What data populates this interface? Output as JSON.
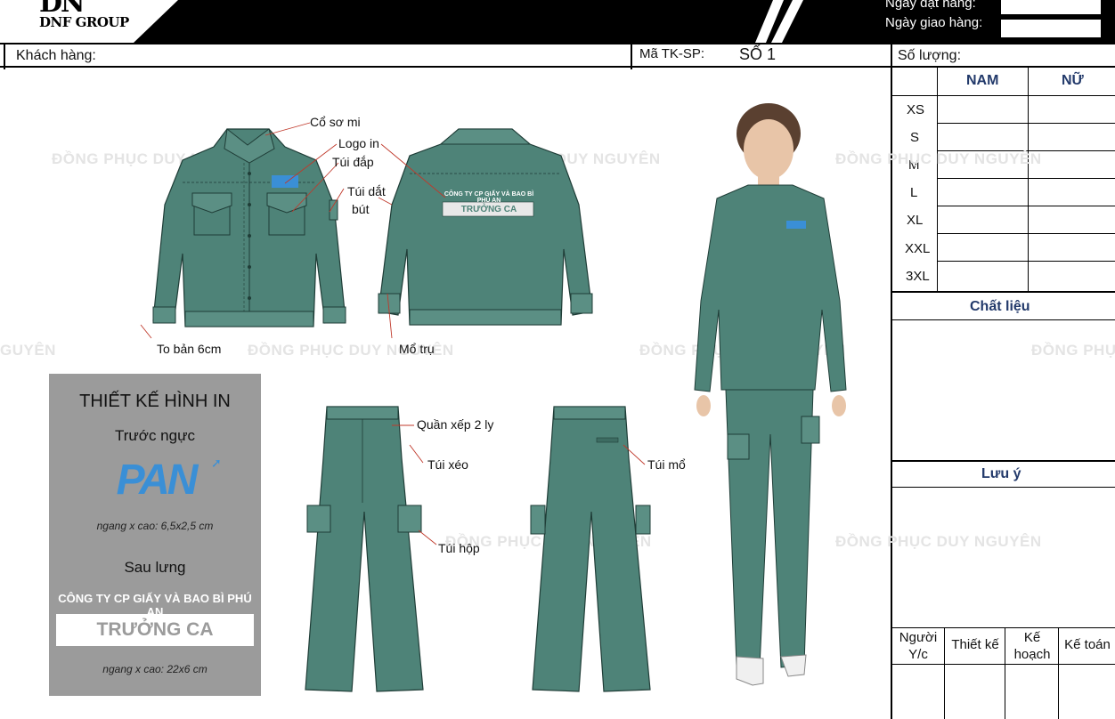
{
  "header": {
    "brand_mark": "DN",
    "brand_name": "DNF GROUP",
    "order_date_label": "Ngày đặt hàng:",
    "delivery_date_label": "Ngày giao hàng:"
  },
  "info_row": {
    "customer_label": "Khách hàng:",
    "design_code_label": "Mã TK-SP:",
    "design_code_value": "SỐ 1",
    "quantity_label": "Số lượng:"
  },
  "size_table": {
    "col_male": "NAM",
    "col_female": "NỮ",
    "sizes": [
      "XS",
      "S",
      "M",
      "L",
      "XL",
      "XXL",
      "3XL"
    ]
  },
  "material_title": "Chất liệu",
  "note_title": "Lưu ý",
  "signatures": [
    "Người Y/c",
    "Thiết kế",
    "Kế hoạch",
    "Kế toán"
  ],
  "watermark": "ĐỒNG PHỤC DUY NGUYÊN",
  "watermark_fragments": {
    "left_cut": "GUYÊN",
    "right_cut": "ĐỒNG PHỤC"
  },
  "annotations": {
    "collar": "Cổ sơ mi",
    "logo_print": "Logo in",
    "patch_pocket": "Túi đắp",
    "pen_pocket_1": "Túi dắt",
    "pen_pocket_2": "bút",
    "cuff": "To bản 6cm",
    "vent": "Mổ trụ",
    "pleat": "Quần xếp 2 ly",
    "slant_pocket": "Túi  xéo",
    "box_pocket": "Túi  hộp",
    "welt_pocket": "Túi  mổ"
  },
  "jacket_back_print": {
    "company": "CÔNG TY CP GIẤY VÀ BAO BÌ PHÚ AN",
    "title": "TRƯỞNG CA"
  },
  "print_design": {
    "title": "THIẾT KẾ HÌNH IN",
    "front_label": "Trước ngực",
    "logo_text": "PAN",
    "front_size": "ngang x cao: 6,5x2,5 cm",
    "back_label": "Sau lưng",
    "back_company": "CÔNG TY CP GIẤY VÀ BAO BÌ PHÚ AN",
    "back_title": "TRƯỞNG CA",
    "back_size": "ngang x cao: 22x6 cm"
  },
  "colors": {
    "garment": "#4e8378",
    "garment_dark": "#2f5a51",
    "logo_blue": "#3a8fd6",
    "panel_gray": "#9b9b9b",
    "heading_navy": "#233a6b"
  }
}
